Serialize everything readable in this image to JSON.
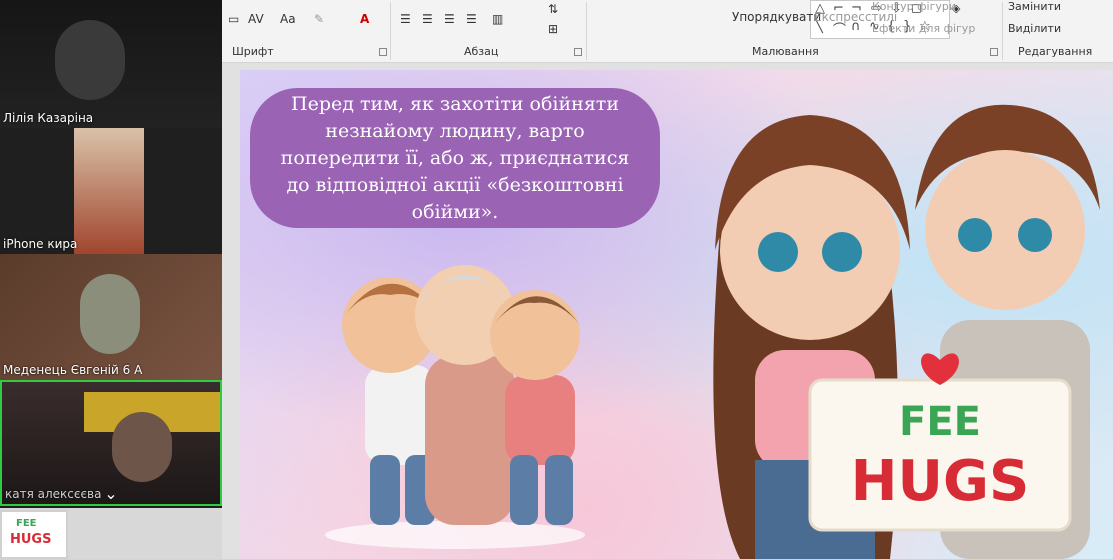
{
  "ribbon": {
    "font_group": "Шрифт",
    "paragraph_group": "Абзац",
    "drawing_group": "Малювання",
    "editing_group": "Редагування",
    "font_ctrl_1": "AV",
    "font_ctrl_2": "Aa",
    "font_ctrl_3": "A",
    "arrange_label": "Упорядкувати",
    "quick_styles_label": "Експресстилі",
    "shape_outline_label": "Контур фігури",
    "shape_effects_label": "Ефекти для фігур",
    "replace_label": "Замінити",
    "select_label": "Виділити"
  },
  "slide": {
    "text": "Перед тим, як захотіти обійняти незнайому людину, варто попередити її, або ж, приєднатися до відповідної акції «безкоштовні обійми».",
    "sign_line1": "FEE",
    "sign_line2": "HUGS"
  },
  "participants": [
    {
      "name": "Лілія Казаріна"
    },
    {
      "name": "iPhone кира"
    },
    {
      "name": "Меденець Євгеній 6 А"
    },
    {
      "name": "катя алексєєва"
    }
  ],
  "thumbnail": {
    "line1": "FEE",
    "line2": "HUGS"
  },
  "colors": {
    "accent": "#9a63b4",
    "active_border": "#2ecc40"
  }
}
